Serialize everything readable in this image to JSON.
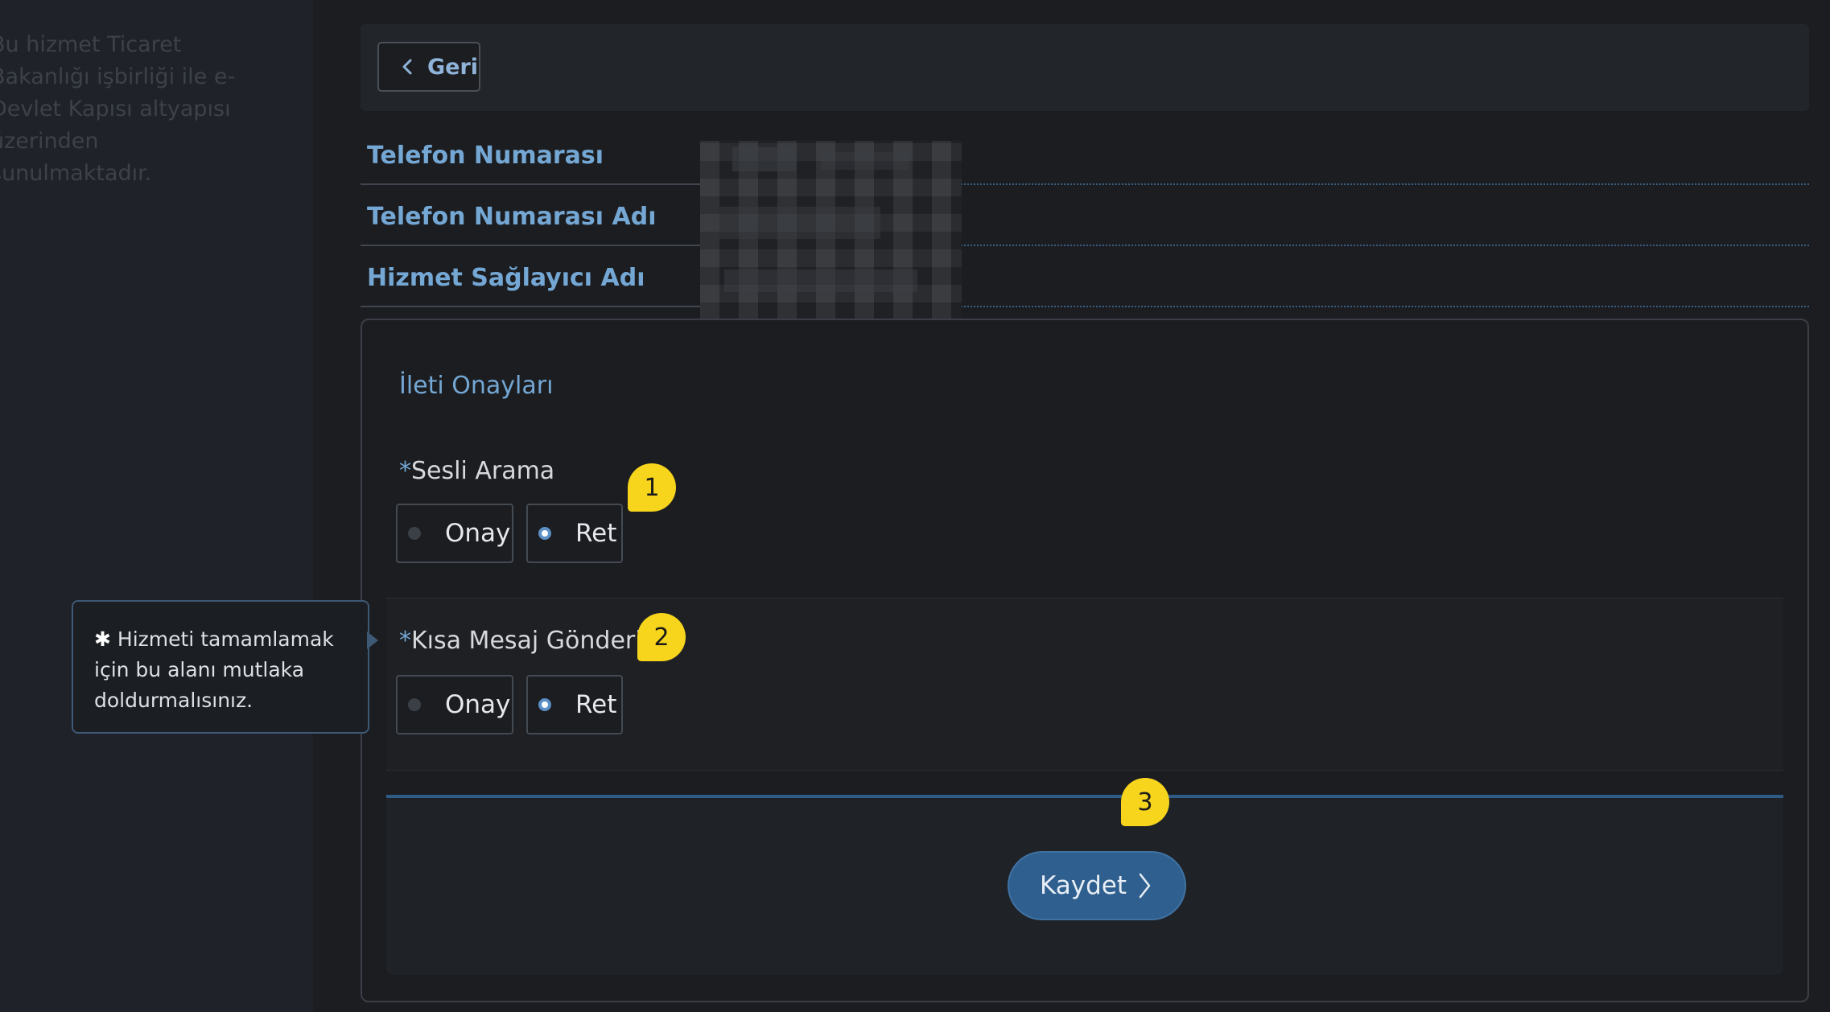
{
  "sidebar": {
    "info_text": "Bu hizmet Ticaret Bakanlığı işbirliği ile e-Devlet Kapısı altyapısı üzerinden sunulmaktadır."
  },
  "toolbar": {
    "back_label": "Geri"
  },
  "details": {
    "phone_number_label": "Telefon Numarası",
    "phone_name_label": "Telefon Numarası Adı",
    "provider_label": "Hizmet Sağlayıcı Adı"
  },
  "form": {
    "section_title": "İleti Onayları",
    "asterisk": "*",
    "voice_call": {
      "label": "Sesli Arama",
      "approve_label": "Onay",
      "reject_label": "Ret",
      "selected": "Ret"
    },
    "sms": {
      "label": "Kısa Mesaj Gönderim",
      "approve_label": "Onay",
      "reject_label": "Ret",
      "selected": "Ret"
    },
    "save_label": "Kaydet"
  },
  "badges": {
    "one": "1",
    "two": "2",
    "three": "3"
  },
  "tooltip": {
    "asterisk": "✱",
    "text": "Hizmeti tamamlamak için bu alanı mutlaka doldurmalısınız."
  },
  "colors": {
    "accent": "#74a7d4",
    "button": "#2f5f8e",
    "badge": "#f7d51d"
  }
}
